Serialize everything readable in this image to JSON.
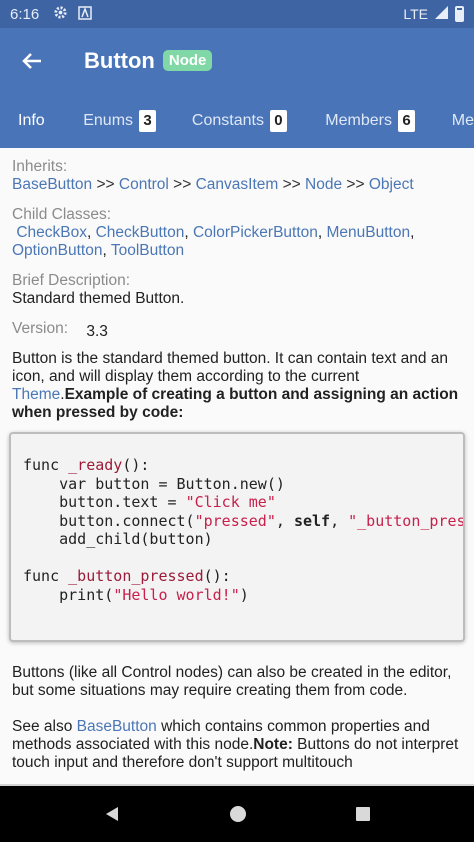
{
  "status_bar": {
    "time": "6:16",
    "network": "LTE"
  },
  "header": {
    "title": "Button",
    "badge": "Node"
  },
  "tabs": [
    {
      "label": "Info"
    },
    {
      "label": "Enums",
      "count": "3"
    },
    {
      "label": "Constants",
      "count": "0"
    },
    {
      "label": "Members",
      "count": "6"
    },
    {
      "label": "Me"
    }
  ],
  "inherits": {
    "label": "Inherits:",
    "items": [
      "BaseButton",
      "Control",
      "CanvasItem",
      "Node",
      "Object"
    ],
    "sep": ">>"
  },
  "child_classes": {
    "label": "Child Classes:",
    "items": [
      "CheckBox",
      "CheckButton",
      "ColorPickerButton",
      "MenuButton",
      "OptionButton",
      "ToolButton"
    ]
  },
  "brief": {
    "label": "Brief Description:",
    "text": "Standard themed Button."
  },
  "version": {
    "label": "Version:",
    "value": "3.3"
  },
  "description": {
    "text1": "Button is the standard themed button. It can contain text and an icon, and will display them according to the current ",
    "theme_link": "Theme",
    "text2": ".",
    "bold_text": "Example of creating a button and assigning an action when pressed by code:"
  },
  "code": {
    "l1_kw": "func ",
    "l1_fn": "_ready",
    "l1_rest": "():",
    "l2": "    var button = Button.new()",
    "l3_a": "    button.text = ",
    "l3_str": "\"Click me\"",
    "l4_a": "    button.connect(",
    "l4_str1": "\"pressed\"",
    "l4_b": ", ",
    "l4_self": "self",
    "l4_c": ", ",
    "l4_str2": "\"_button_pressed\"",
    "l4_d": ")",
    "l5": "    add_child(button)",
    "l7_kw": "func ",
    "l7_fn": "_button_pressed",
    "l7_rest": "():",
    "l8_a": "    print(",
    "l8_str": "\"Hello world!\"",
    "l8_b": ")"
  },
  "para2": {
    "text": "Buttons (like all Control nodes) can also be created in the editor, but some situations may require creating them from code."
  },
  "para3": {
    "a": "See also ",
    "link": "BaseButton",
    "b": " which contains common properties and methods associated with this node.",
    "note_bold": "Note:",
    "c": " Buttons do not interpret touch input and therefore don't support multitouch"
  }
}
